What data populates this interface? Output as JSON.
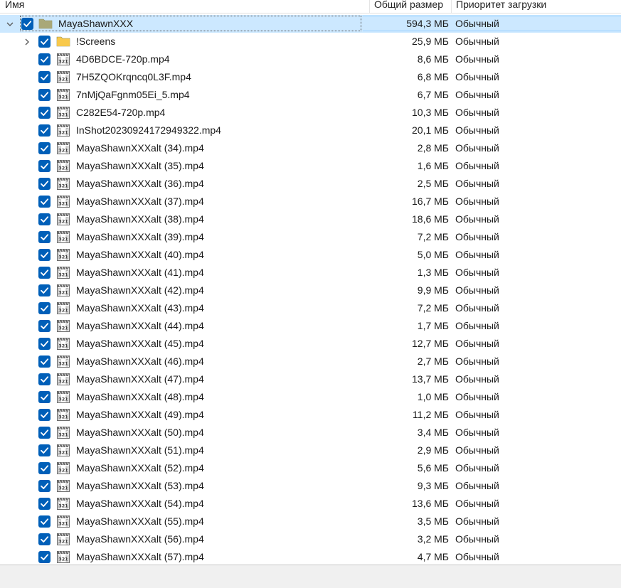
{
  "columns": {
    "name": "Имя",
    "size": "Общий размер",
    "priority": "Приоритет загрузки"
  },
  "colors": {
    "selection": "#cce8ff",
    "checkbox": "#005fb8",
    "folder_root": "#a9a878",
    "folder_sub": "#f8c94c"
  },
  "rows": [
    {
      "type": "root",
      "expanded": true,
      "checked": true,
      "icon": "folder-icon",
      "name": "MayaShawnXXX",
      "size": "594,3 МБ",
      "priority": "Обычный"
    },
    {
      "type": "folder",
      "expanded": false,
      "checked": true,
      "icon": "folder-icon",
      "name": "!Screens",
      "size": "25,9 МБ",
      "priority": "Обычный"
    },
    {
      "type": "file",
      "checked": true,
      "icon": "video-file-icon",
      "name": "4D6BDCE-720p.mp4",
      "size": "8,6 МБ",
      "priority": "Обычный"
    },
    {
      "type": "file",
      "checked": true,
      "icon": "video-file-icon",
      "name": "7H5ZQOKrqncq0L3F.mp4",
      "size": "6,8 МБ",
      "priority": "Обычный"
    },
    {
      "type": "file",
      "checked": true,
      "icon": "video-file-icon",
      "name": "7nMjQaFgnm05Ei_5.mp4",
      "size": "6,7 МБ",
      "priority": "Обычный"
    },
    {
      "type": "file",
      "checked": true,
      "icon": "video-file-icon",
      "name": "C282E54-720p.mp4",
      "size": "10,3 МБ",
      "priority": "Обычный"
    },
    {
      "type": "file",
      "checked": true,
      "icon": "video-file-icon",
      "name": "InShot20230924172949322.mp4",
      "size": "20,1 МБ",
      "priority": "Обычный"
    },
    {
      "type": "file",
      "checked": true,
      "icon": "video-file-icon",
      "name": "MayaShawnXXXalt (34).mp4",
      "size": "2,8 МБ",
      "priority": "Обычный"
    },
    {
      "type": "file",
      "checked": true,
      "icon": "video-file-icon",
      "name": "MayaShawnXXXalt (35).mp4",
      "size": "1,6 МБ",
      "priority": "Обычный"
    },
    {
      "type": "file",
      "checked": true,
      "icon": "video-file-icon",
      "name": "MayaShawnXXXalt (36).mp4",
      "size": "2,5 МБ",
      "priority": "Обычный"
    },
    {
      "type": "file",
      "checked": true,
      "icon": "video-file-icon",
      "name": "MayaShawnXXXalt (37).mp4",
      "size": "16,7 МБ",
      "priority": "Обычный"
    },
    {
      "type": "file",
      "checked": true,
      "icon": "video-file-icon",
      "name": "MayaShawnXXXalt (38).mp4",
      "size": "18,6 МБ",
      "priority": "Обычный"
    },
    {
      "type": "file",
      "checked": true,
      "icon": "video-file-icon",
      "name": "MayaShawnXXXalt (39).mp4",
      "size": "7,2 МБ",
      "priority": "Обычный"
    },
    {
      "type": "file",
      "checked": true,
      "icon": "video-file-icon",
      "name": "MayaShawnXXXalt (40).mp4",
      "size": "5,0 МБ",
      "priority": "Обычный"
    },
    {
      "type": "file",
      "checked": true,
      "icon": "video-file-icon",
      "name": "MayaShawnXXXalt (41).mp4",
      "size": "1,3 МБ",
      "priority": "Обычный"
    },
    {
      "type": "file",
      "checked": true,
      "icon": "video-file-icon",
      "name": "MayaShawnXXXalt (42).mp4",
      "size": "9,9 МБ",
      "priority": "Обычный"
    },
    {
      "type": "file",
      "checked": true,
      "icon": "video-file-icon",
      "name": "MayaShawnXXXalt (43).mp4",
      "size": "7,2 МБ",
      "priority": "Обычный"
    },
    {
      "type": "file",
      "checked": true,
      "icon": "video-file-icon",
      "name": "MayaShawnXXXalt (44).mp4",
      "size": "1,7 МБ",
      "priority": "Обычный"
    },
    {
      "type": "file",
      "checked": true,
      "icon": "video-file-icon",
      "name": "MayaShawnXXXalt (45).mp4",
      "size": "12,7 МБ",
      "priority": "Обычный"
    },
    {
      "type": "file",
      "checked": true,
      "icon": "video-file-icon",
      "name": "MayaShawnXXXalt (46).mp4",
      "size": "2,7 МБ",
      "priority": "Обычный"
    },
    {
      "type": "file",
      "checked": true,
      "icon": "video-file-icon",
      "name": "MayaShawnXXXalt (47).mp4",
      "size": "13,7 МБ",
      "priority": "Обычный"
    },
    {
      "type": "file",
      "checked": true,
      "icon": "video-file-icon",
      "name": "MayaShawnXXXalt (48).mp4",
      "size": "1,0 МБ",
      "priority": "Обычный"
    },
    {
      "type": "file",
      "checked": true,
      "icon": "video-file-icon",
      "name": "MayaShawnXXXalt (49).mp4",
      "size": "11,2 МБ",
      "priority": "Обычный"
    },
    {
      "type": "file",
      "checked": true,
      "icon": "video-file-icon",
      "name": "MayaShawnXXXalt (50).mp4",
      "size": "3,4 МБ",
      "priority": "Обычный"
    },
    {
      "type": "file",
      "checked": true,
      "icon": "video-file-icon",
      "name": "MayaShawnXXXalt (51).mp4",
      "size": "2,9 МБ",
      "priority": "Обычный"
    },
    {
      "type": "file",
      "checked": true,
      "icon": "video-file-icon",
      "name": "MayaShawnXXXalt (52).mp4",
      "size": "5,6 МБ",
      "priority": "Обычный"
    },
    {
      "type": "file",
      "checked": true,
      "icon": "video-file-icon",
      "name": "MayaShawnXXXalt (53).mp4",
      "size": "9,3 МБ",
      "priority": "Обычный"
    },
    {
      "type": "file",
      "checked": true,
      "icon": "video-file-icon",
      "name": "MayaShawnXXXalt (54).mp4",
      "size": "13,6 МБ",
      "priority": "Обычный"
    },
    {
      "type": "file",
      "checked": true,
      "icon": "video-file-icon",
      "name": "MayaShawnXXXalt (55).mp4",
      "size": "3,5 МБ",
      "priority": "Обычный"
    },
    {
      "type": "file",
      "checked": true,
      "icon": "video-file-icon",
      "name": "MayaShawnXXXalt (56).mp4",
      "size": "3,2 МБ",
      "priority": "Обычный"
    },
    {
      "type": "file",
      "checked": true,
      "icon": "video-file-icon",
      "name": "MayaShawnXXXalt (57).mp4",
      "size": "4,7 МБ",
      "priority": "Обычный"
    }
  ]
}
